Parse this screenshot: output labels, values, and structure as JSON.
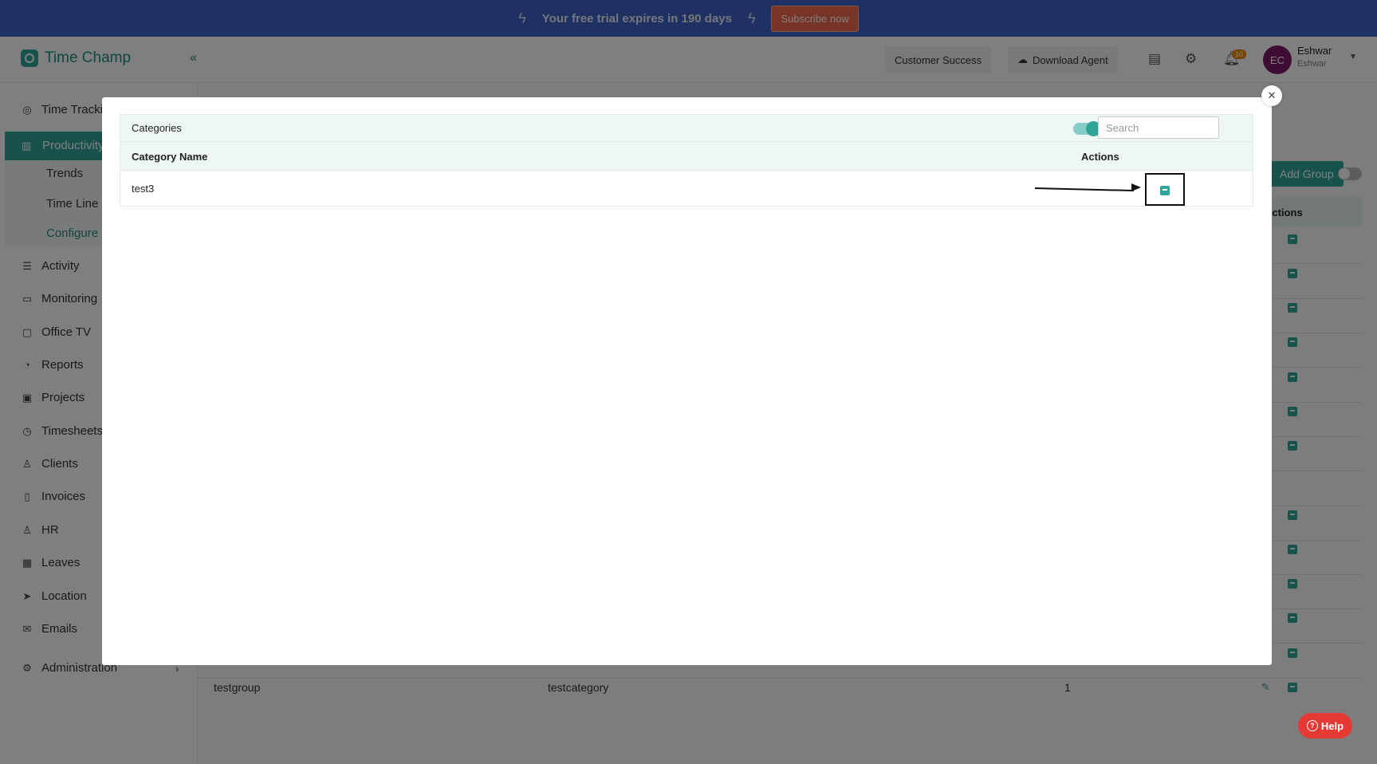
{
  "banner": {
    "trial_text": "Your free trial expires in 190 days",
    "subscribe_label": "Subscribe now"
  },
  "header": {
    "brand": "Time Champ",
    "customer_success_label": "Customer Success",
    "download_agent_label": "Download Agent",
    "notification_count": "10",
    "user": {
      "initials": "EC",
      "name": "Eshwar",
      "subtitle": "Eshwar"
    }
  },
  "sidebar": {
    "items": [
      {
        "label": "Time Tracking",
        "icon": "target-icon"
      },
      {
        "label": "Productivity",
        "icon": "chart-icon"
      },
      {
        "label": "Activity",
        "icon": "activity-icon"
      },
      {
        "label": "Monitoring",
        "icon": "monitor-icon"
      },
      {
        "label": "Office TV",
        "icon": "tv-icon"
      },
      {
        "label": "Reports",
        "icon": "pie-chart-icon"
      },
      {
        "label": "Projects",
        "icon": "briefcase-icon"
      },
      {
        "label": "Timesheets",
        "icon": "clock-icon"
      },
      {
        "label": "Clients",
        "icon": "user-icon"
      },
      {
        "label": "Invoices",
        "icon": "invoice-icon"
      },
      {
        "label": "HR",
        "icon": "person-icon"
      },
      {
        "label": "Leaves",
        "icon": "calendar-icon"
      },
      {
        "label": "Location",
        "icon": "location-arrow-icon"
      },
      {
        "label": "Emails",
        "icon": "mail-icon"
      },
      {
        "label": "Administration",
        "icon": "gear-icon"
      }
    ],
    "productivity_sub": [
      "Trends",
      "Time Line",
      "Configure"
    ]
  },
  "background_page": {
    "add_group_label": "Add Group",
    "actions_header": "Actions",
    "last_row": {
      "group": "testgroup",
      "category": "testcategory",
      "count": "1"
    }
  },
  "modal": {
    "title": "Categories",
    "search_placeholder": "Search",
    "columns": {
      "name": "Category Name",
      "actions": "Actions"
    },
    "rows": [
      {
        "name": "test3"
      }
    ]
  },
  "help_label": "Help",
  "colors": {
    "accent": "#2fa49a",
    "banner": "#3d63c4",
    "subscribe": "#f0684d",
    "help": "#e53935"
  }
}
